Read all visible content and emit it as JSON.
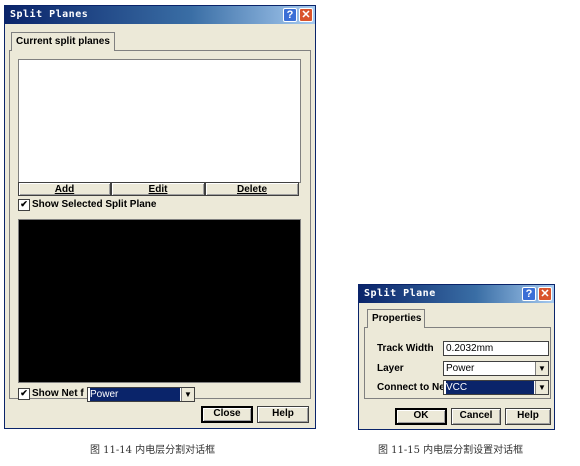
{
  "dialog1": {
    "title": "Split Planes",
    "help_glyph": "?",
    "close_glyph": "✕",
    "tab_label": "Current split planes",
    "add_label": "Add",
    "edit_label": "Edit",
    "delete_label": "Delete",
    "show_selected_label": "Show Selected Split Plane",
    "show_selected_checked": "✔",
    "show_net_label": "Show Net f",
    "show_net_checked": "✔",
    "net_value": "Power",
    "close_label": "Close",
    "help_label": "Help"
  },
  "dialog2": {
    "title": "Split Plane",
    "help_glyph": "?",
    "close_glyph": "✕",
    "tab_label": "Properties",
    "track_width_label": "Track Width",
    "track_width_value": "0.2032mm",
    "layer_label": "Layer",
    "layer_value": "Power",
    "connect_label": "Connect to Ne",
    "connect_value": "VCC",
    "ok_label": "OK",
    "cancel_label": "Cancel",
    "help_label": "Help"
  },
  "captions": {
    "fig1": "图 11-14    内电层分割对话框",
    "fig2": "图 11-15    内电层分割设置对话框"
  },
  "colors": {
    "title_bar": "#0a246a",
    "dialog_bg": "#ece9d8",
    "preview_bg": "#000000"
  }
}
